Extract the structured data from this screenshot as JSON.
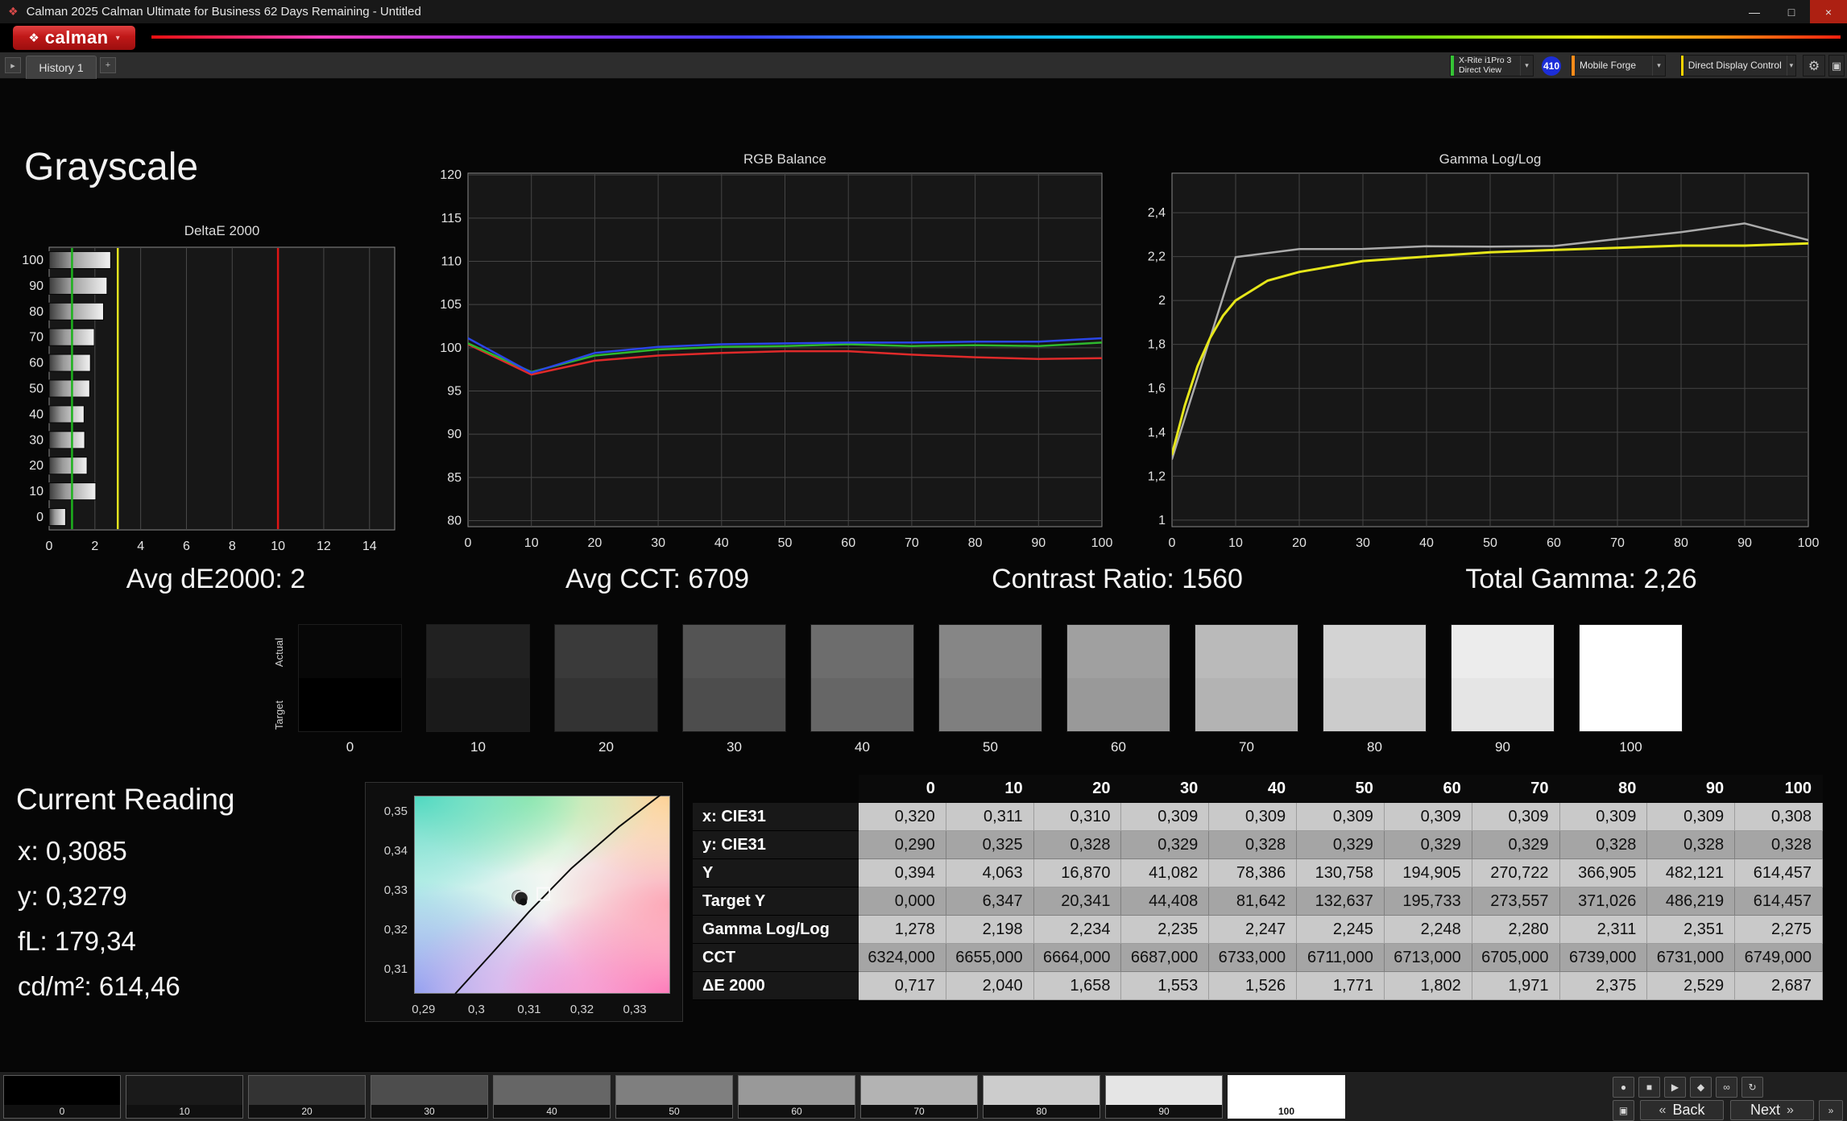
{
  "window": {
    "title": "Calman 2025 Calman Ultimate for Business 62 Days Remaining  - Untitled"
  },
  "brand": {
    "logo_text": "calman"
  },
  "icons": {
    "app_diamond": "❖",
    "logo_diamond": "❖",
    "chevron_down": "▾",
    "history_prev": "▸",
    "history_add": "+",
    "minimize": "—",
    "maximize": "□",
    "close": "×",
    "gear": "⚙",
    "panel": "▣",
    "record": "●",
    "stop": "■",
    "play": "▶",
    "save": "◆",
    "loop": "∞",
    "refresh": "↻",
    "back_arrow": "«",
    "skip": "»"
  },
  "workspace_tabs": {
    "history_tab": "History 1"
  },
  "device_toolbar": {
    "meter": {
      "line1": "X-Rite i1Pro 3",
      "line2": "Direct View",
      "accent": "#35c435"
    },
    "meter_badge": "410",
    "meter_badge_color": "#1c2ed8",
    "pattern_source": {
      "label": "Mobile Forge",
      "accent": "#ff8c1a"
    },
    "display_control": {
      "label": "Direct Display Control",
      "accent": "#ffd500"
    }
  },
  "page": {
    "title": "Grayscale"
  },
  "summary": {
    "avg_de": "Avg dE2000: 2",
    "avg_cct": "Avg CCT: 6709",
    "contrast": "Contrast Ratio: 1560",
    "total_gamma": "Total Gamma: 2,26"
  },
  "chart_data": [
    {
      "id": "deltae",
      "type": "bar",
      "title": "DeltaE 2000",
      "orientation": "horizontal",
      "categories": [
        "100",
        "90",
        "80",
        "70",
        "60",
        "50",
        "40",
        "30",
        "20",
        "10",
        "0"
      ],
      "values": [
        2.687,
        2.529,
        2.375,
        1.971,
        1.802,
        1.771,
        1.526,
        1.553,
        1.658,
        2.04,
        0.717
      ],
      "xlim": [
        0,
        15.1
      ],
      "xticks": [
        0,
        2,
        4,
        6,
        8,
        10,
        12,
        14
      ],
      "reference_lines": [
        {
          "value": 1,
          "color": "#1db21d",
          "meaning": "good"
        },
        {
          "value": 3,
          "color": "#e3e31e",
          "meaning": "warning"
        },
        {
          "value": 10,
          "color": "#e01515",
          "meaning": "bad"
        }
      ]
    },
    {
      "id": "rgb-balance",
      "type": "line",
      "title": "RGB Balance",
      "x": [
        0,
        10,
        20,
        30,
        40,
        50,
        60,
        70,
        80,
        90,
        100
      ],
      "xticks": [
        0,
        10,
        20,
        30,
        40,
        50,
        60,
        70,
        80,
        90,
        100
      ],
      "ylim": [
        79.3,
        120.2
      ],
      "yticks": [
        120,
        115,
        110,
        105,
        100,
        95,
        90,
        85,
        80
      ],
      "series": [
        {
          "name": "Red",
          "color": "#e02a2a",
          "values": [
            100.4,
            96.9,
            98.5,
            99.1,
            99.4,
            99.6,
            99.6,
            99.2,
            98.9,
            98.7,
            98.8
          ]
        },
        {
          "name": "Green",
          "color": "#2eb82e",
          "values": [
            100.5,
            97.2,
            99.1,
            99.8,
            100.1,
            100.2,
            100.4,
            100.2,
            100.3,
            100.2,
            100.6
          ]
        },
        {
          "name": "Blue",
          "color": "#2a46e8",
          "values": [
            101.1,
            97.1,
            99.4,
            100.1,
            100.4,
            100.5,
            100.6,
            100.6,
            100.7,
            100.7,
            101.1
          ]
        }
      ]
    },
    {
      "id": "gamma",
      "type": "line",
      "title": "Gamma Log/Log",
      "xticks": [
        0,
        10,
        20,
        30,
        40,
        50,
        60,
        70,
        80,
        90,
        100
      ],
      "ylim": [
        0.97,
        2.58
      ],
      "yticks": [
        {
          "value": 2.4,
          "label": "2,4"
        },
        {
          "value": 2.2,
          "label": "2,2"
        },
        {
          "value": 2.0,
          "label": "2"
        },
        {
          "value": 1.8,
          "label": "1,8"
        },
        {
          "value": 1.6,
          "label": "1,6"
        },
        {
          "value": 1.4,
          "label": "1,4"
        },
        {
          "value": 1.2,
          "label": "1,2"
        },
        {
          "value": 1.0,
          "label": "1"
        }
      ],
      "series": [
        {
          "name": "Measured",
          "color": "#ababab",
          "x": [
            0,
            10,
            20,
            30,
            40,
            50,
            60,
            70,
            80,
            90,
            100
          ],
          "values": [
            1.278,
            2.198,
            2.234,
            2.235,
            2.247,
            2.245,
            2.248,
            2.28,
            2.311,
            2.351,
            2.275
          ]
        },
        {
          "name": "Target",
          "color": "#e6e61a",
          "x": [
            0,
            2,
            4,
            6,
            8,
            10,
            15,
            20,
            30,
            40,
            50,
            60,
            70,
            80,
            90,
            100
          ],
          "values": [
            1.3,
            1.52,
            1.7,
            1.83,
            1.93,
            2.0,
            2.09,
            2.13,
            2.18,
            2.2,
            2.22,
            2.23,
            2.24,
            2.25,
            2.25,
            2.26
          ]
        }
      ]
    },
    {
      "id": "cie-detail",
      "type": "scatter",
      "title": "CIE xy detail",
      "xlim": [
        0.2882,
        0.3367
      ],
      "ylim": [
        0.3037,
        0.3539
      ],
      "xticks": [
        {
          "value": 0.29,
          "label": "0,29"
        },
        {
          "value": 0.3,
          "label": "0,3"
        },
        {
          "value": 0.31,
          "label": "0,31"
        },
        {
          "value": 0.32,
          "label": "0,32"
        },
        {
          "value": 0.33,
          "label": "0,33"
        }
      ],
      "yticks": [
        {
          "value": 0.35,
          "label": "0,35"
        },
        {
          "value": 0.34,
          "label": "0,34"
        },
        {
          "value": 0.33,
          "label": "0,33"
        },
        {
          "value": 0.32,
          "label": "0,32"
        },
        {
          "value": 0.31,
          "label": "0,31"
        }
      ],
      "target": {
        "x": 0.3127,
        "y": 0.329
      },
      "points": [
        {
          "x": 0.3079,
          "y": 0.3284,
          "style": "measured-gray"
        },
        {
          "x": 0.3085,
          "y": 0.3279,
          "style": "measured-large"
        },
        {
          "x": 0.3089,
          "y": 0.327,
          "style": "measured-dot"
        }
      ],
      "locus": [
        [
          0.296,
          0.3037
        ],
        [
          0.303,
          0.314
        ],
        [
          0.31,
          0.3245
        ],
        [
          0.318,
          0.3355
        ],
        [
          0.327,
          0.346
        ],
        [
          0.3367,
          0.356
        ]
      ]
    }
  ],
  "swatch_strip": {
    "row_labels": [
      "Actual",
      "Target"
    ],
    "levels": [
      0,
      10,
      20,
      30,
      40,
      50,
      60,
      70,
      80,
      90,
      100
    ]
  },
  "current_reading": {
    "title": "Current Reading",
    "x": "x: 0,3085",
    "y": "y: 0,3279",
    "fl": "fL: 179,34",
    "cdm2": "cd/m²: 614,46"
  },
  "table": {
    "columns": [
      "0",
      "10",
      "20",
      "30",
      "40",
      "50",
      "60",
      "70",
      "80",
      "90",
      "100"
    ],
    "rows": [
      {
        "label": "x: CIE31",
        "values": [
          "0,320",
          "0,311",
          "0,310",
          "0,309",
          "0,309",
          "0,309",
          "0,309",
          "0,309",
          "0,309",
          "0,309",
          "0,308"
        ]
      },
      {
        "label": "y: CIE31",
        "values": [
          "0,290",
          "0,325",
          "0,328",
          "0,329",
          "0,328",
          "0,329",
          "0,329",
          "0,329",
          "0,328",
          "0,328",
          "0,328"
        ]
      },
      {
        "label": "Y",
        "values": [
          "0,394",
          "4,063",
          "16,870",
          "41,082",
          "78,386",
          "130,758",
          "194,905",
          "270,722",
          "366,905",
          "482,121",
          "614,457"
        ]
      },
      {
        "label": "Target Y",
        "values": [
          "0,000",
          "6,347",
          "20,341",
          "44,408",
          "81,642",
          "132,637",
          "195,733",
          "273,557",
          "371,026",
          "486,219",
          "614,457"
        ]
      },
      {
        "label": "Gamma Log/Log",
        "values": [
          "1,278",
          "2,198",
          "2,234",
          "2,235",
          "2,247",
          "2,245",
          "2,248",
          "2,280",
          "2,311",
          "2,351",
          "2,275"
        ]
      },
      {
        "label": "CCT",
        "values": [
          "6324,000",
          "6655,000",
          "6664,000",
          "6687,000",
          "6733,000",
          "6711,000",
          "6713,000",
          "6705,000",
          "6739,000",
          "6731,000",
          "6749,000"
        ]
      },
      {
        "label": "ΔE 2000",
        "values": [
          "0,717",
          "2,040",
          "1,658",
          "1,553",
          "1,526",
          "1,771",
          "1,802",
          "1,971",
          "2,375",
          "2,529",
          "2,687"
        ]
      }
    ]
  },
  "pattern_bar": {
    "patches": [
      "0",
      "10",
      "20",
      "30",
      "40",
      "50",
      "60",
      "70",
      "80",
      "90",
      "100"
    ],
    "selected": "100",
    "back_label": "Back",
    "next_label": "Next"
  }
}
